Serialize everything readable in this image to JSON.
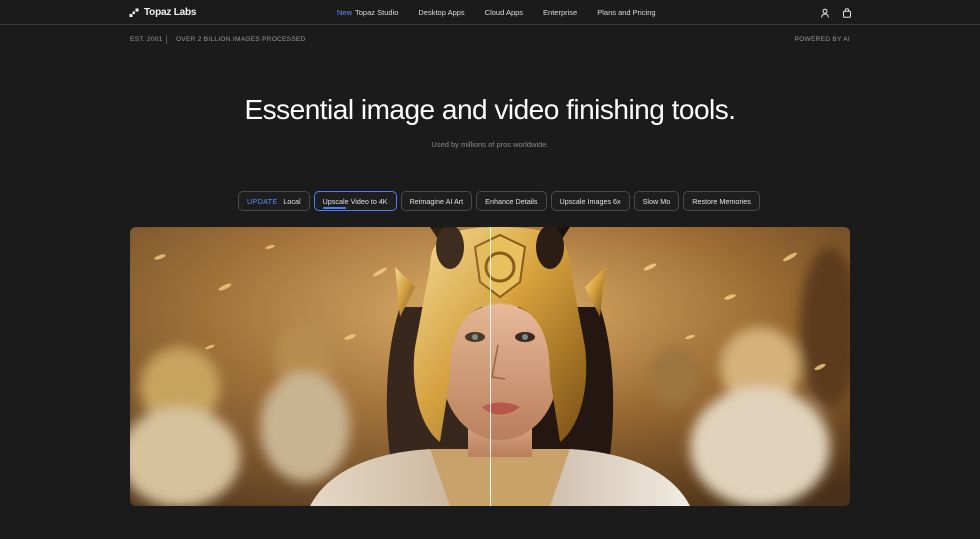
{
  "nav": {
    "brand": "Topaz Labs",
    "new_badge": "New",
    "items": [
      "Topaz Studio",
      "Desktop Apps",
      "Cloud Apps",
      "Enterprise",
      "Plans and Pricing"
    ],
    "icons": [
      "user-icon",
      "bag-icon"
    ]
  },
  "subbar": {
    "est": "EST. 2001",
    "processed": "OVER 2 BILLION IMAGES PROCESSED",
    "powered": "POWERED BY AI"
  },
  "hero": {
    "headline": "Essential image and video finishing tools.",
    "subline": "Used by millions of pros worldwide."
  },
  "pills": {
    "update_badge": "UPDATE",
    "items": [
      "Local",
      "Upscale Video to 4K",
      "Reimagine AI Art",
      "Enhance Details",
      "Upscale Images 6x",
      "Slow Mo",
      "Restore Memories"
    ],
    "active_index": 1,
    "active_progress": 0.35
  },
  "colors": {
    "background": "#1b1b1b",
    "accent": "#4d7cff",
    "gold": "#d4a23a"
  }
}
